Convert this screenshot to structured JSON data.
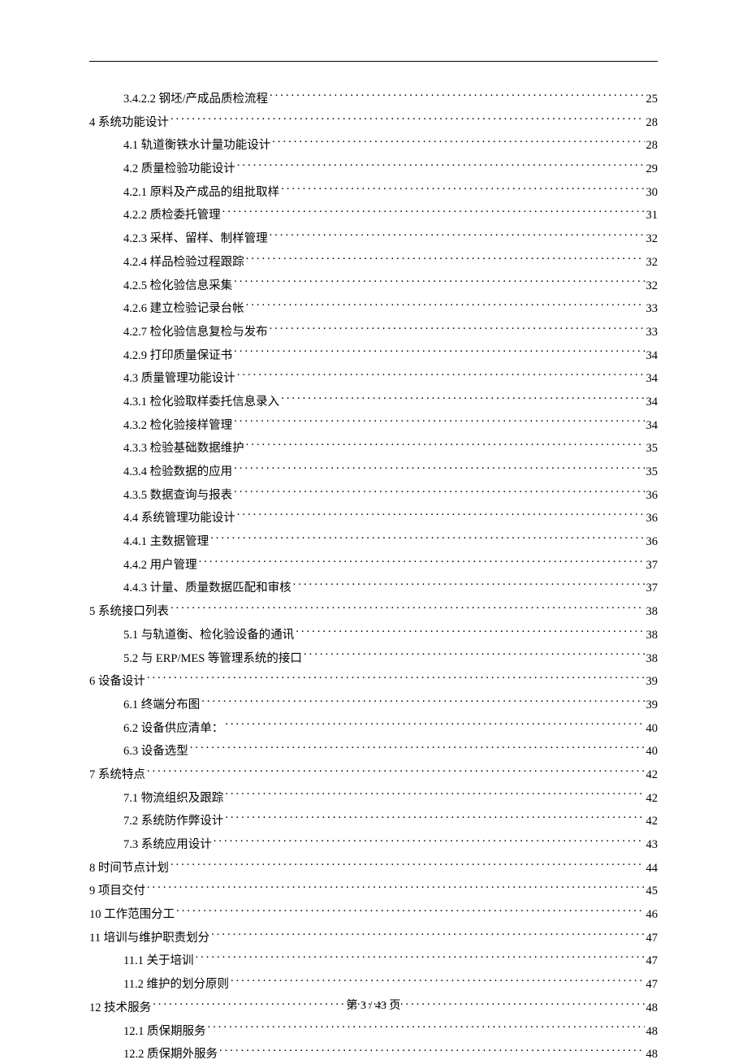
{
  "toc": [
    {
      "level": 2,
      "label": "3.4.2.2 钢坯/产成品质检流程",
      "page": "25"
    },
    {
      "level": 0,
      "label": "4 系统功能设计",
      "page": "28"
    },
    {
      "level": 1,
      "label": "4.1 轨道衡铁水计量功能设计",
      "page": "28"
    },
    {
      "level": 1,
      "label": "4.2 质量检验功能设计",
      "page": "29"
    },
    {
      "level": 1,
      "label": "4.2.1 原料及产成品的组批取样",
      "page": "30"
    },
    {
      "level": 1,
      "label": "4.2.2 质检委托管理",
      "page": "31"
    },
    {
      "level": 1,
      "label": "4.2.3 采样、留样、制样管理",
      "page": "32"
    },
    {
      "level": 1,
      "label": "4.2.4 样品检验过程跟踪",
      "page": "32"
    },
    {
      "level": 1,
      "label": "4.2.5 检化验信息采集",
      "page": "32"
    },
    {
      "level": 1,
      "label": "4.2.6 建立检验记录台帐",
      "page": "33"
    },
    {
      "level": 1,
      "label": "4.2.7 检化验信息复检与发布",
      "page": "33"
    },
    {
      "level": 1,
      "label": "4.2.9 打印质量保证书",
      "page": "34"
    },
    {
      "level": 1,
      "label": "4.3  质量管理功能设计",
      "page": "34"
    },
    {
      "level": 1,
      "label": "4.3.1 检化验取样委托信息录入",
      "page": "34"
    },
    {
      "level": 1,
      "label": "4.3.2 检化验接样管理",
      "page": "34"
    },
    {
      "level": 1,
      "label": "4.3.3 检验基础数据维护",
      "page": "35"
    },
    {
      "level": 1,
      "label": "4.3.4 检验数据的应用",
      "page": "35"
    },
    {
      "level": 1,
      "label": "4.3.5 数据查询与报表",
      "page": "36"
    },
    {
      "level": 1,
      "label": "4.4  系统管理功能设计",
      "page": "36"
    },
    {
      "level": 1,
      "label": "4.4.1 主数据管理",
      "page": "36"
    },
    {
      "level": 1,
      "label": "4.4.2 用户管理",
      "page": "37"
    },
    {
      "level": 1,
      "label": "4.4.3 计量、质量数据匹配和审核",
      "page": "37"
    },
    {
      "level": 0,
      "label": "5 系统接口列表",
      "page": "38"
    },
    {
      "level": 1,
      "label": "5.1 与轨道衡、检化验设备的通讯",
      "page": "38"
    },
    {
      "level": 1,
      "label": "5.2 与 ERP/MES 等管理系统的接口",
      "page": "38"
    },
    {
      "level": 0,
      "label": "6 设备设计",
      "page": "39"
    },
    {
      "level": 1,
      "label": "6.1  终端分布图",
      "page": "39"
    },
    {
      "level": 1,
      "label": "6.2 设备供应清单：",
      "page": "40"
    },
    {
      "level": 1,
      "label": "6.3 设备选型",
      "page": "40"
    },
    {
      "level": 0,
      "label": "7 系统特点",
      "page": "42"
    },
    {
      "level": 1,
      "label": "7.1 物流组织及跟踪",
      "page": "42"
    },
    {
      "level": 1,
      "label": "7.2 系统防作弊设计",
      "page": "42"
    },
    {
      "level": 1,
      "label": "7.3 系统应用设计",
      "page": "43"
    },
    {
      "level": 0,
      "label": "8 时间节点计划",
      "page": "44"
    },
    {
      "level": 0,
      "label": "9 项目交付",
      "page": "45"
    },
    {
      "level": 0,
      "label": "10 工作范围分工",
      "page": "46"
    },
    {
      "level": 0,
      "label": "11 培训与维护职责划分",
      "page": "47"
    },
    {
      "level": 1,
      "label": "11.1 关于培训",
      "page": "47"
    },
    {
      "level": 1,
      "label": "11.2 维护的划分原则",
      "page": "47"
    },
    {
      "level": 0,
      "label": "12 技术服务",
      "page": "48"
    },
    {
      "level": 1,
      "label": "12.1 质保期服务",
      "page": "48"
    },
    {
      "level": 1,
      "label": "12.2 质保期外服务",
      "page": "48"
    }
  ],
  "footer": "第 3 / 43 页"
}
